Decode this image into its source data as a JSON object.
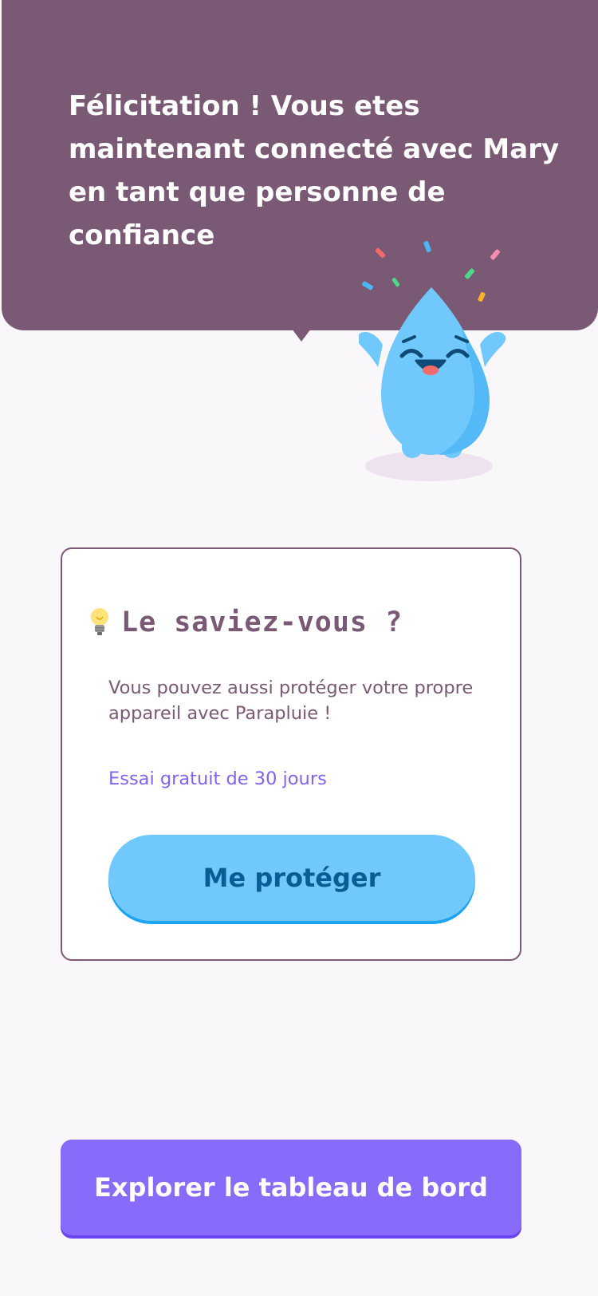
{
  "banner": {
    "title": "Félicitation ! Vous etes maintenant connecté avec Mary en tant que personne de confiance",
    "mascot_icon": "happy-water-drop-mascot",
    "background_color": "#7A5975"
  },
  "info_card": {
    "icon": "lightbulb-icon",
    "title": "Le saviez-vous ?",
    "body": "Vous pouvez aussi protéger votre propre appareil avec Parapluie !",
    "trial": "Essai gratuit de 30 jours",
    "button_label": "Me protéger",
    "border_color": "#7A5975",
    "trial_color": "#7F63F2",
    "button_color": "#71C8FC"
  },
  "footer": {
    "button_label": "Explorer le tableau de bord",
    "button_color": "#886BFA"
  }
}
